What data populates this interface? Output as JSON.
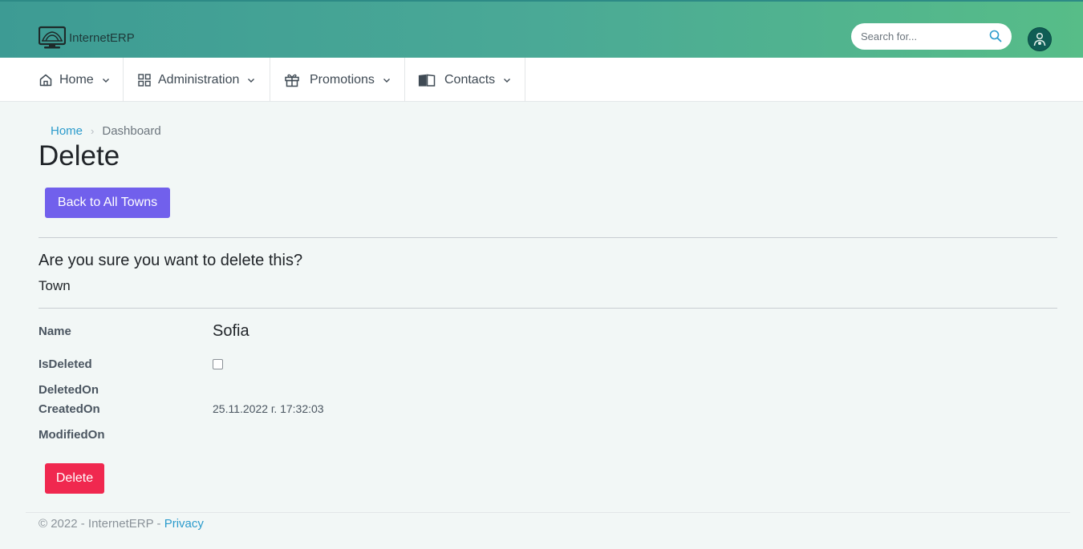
{
  "brand": {
    "name": "InternetERP",
    "logo_icon": "monitor-logo-icon"
  },
  "search": {
    "placeholder": "Search for..."
  },
  "nav": {
    "items": [
      {
        "label": "Home",
        "icon": "home-icon"
      },
      {
        "label": "Administration",
        "icon": "grid-icon"
      },
      {
        "label": "Promotions",
        "icon": "gift-icon"
      },
      {
        "label": "Contacts",
        "icon": "book-icon"
      }
    ]
  },
  "breadcrumb": {
    "home": "Home",
    "separator": "›",
    "current": "Dashboard"
  },
  "page": {
    "title": "Delete",
    "back_button": "Back to All Towns",
    "confirm_text": "Are you sure you want to delete this?",
    "entity": "Town"
  },
  "details": {
    "labels": {
      "name": "Name",
      "is_deleted": "IsDeleted",
      "deleted_on": "DeletedOn",
      "created_on": "CreatedOn",
      "modified_on": "ModifiedOn"
    },
    "values": {
      "name": "Sofia",
      "is_deleted": false,
      "deleted_on": "",
      "created_on": "25.11.2022 г. 17:32:03",
      "modified_on": ""
    }
  },
  "delete_button": "Delete",
  "footer": {
    "text": "© 2022 - InternetERP - ",
    "privacy_link": "Privacy"
  },
  "colors": {
    "header_gradient_start": "#3d9b94",
    "header_gradient_end": "#57bd88",
    "primary_button": "#7160ec",
    "danger_button": "#f0284f",
    "link": "#2b9bcc"
  }
}
